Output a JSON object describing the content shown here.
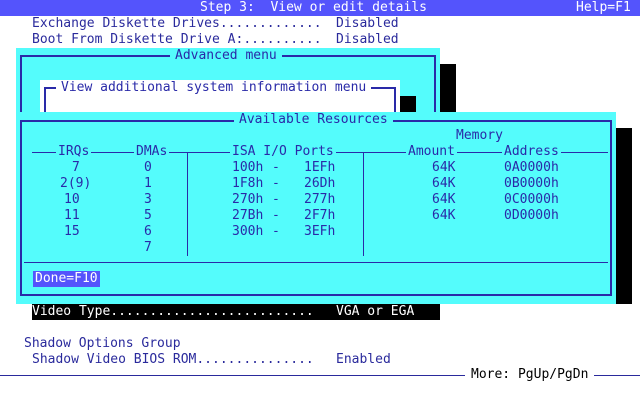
{
  "header": {
    "title": "Step 3:  View or edit details",
    "help": "Help=F1"
  },
  "background": {
    "rows_top": [
      {
        "label": "Exchange Diskette Drives.............",
        "value": "Disabled"
      },
      {
        "label": "Boot From Diskette Drive A:..........",
        "value": "Disabled"
      }
    ],
    "video_row": {
      "label": "Video Type..........................",
      "value": "VGA or EGA"
    },
    "shadow_group_title": "Shadow Options Group",
    "shadow_row": {
      "label": "Shadow Video BIOS ROM...............",
      "value": "Enabled"
    }
  },
  "advanced_menu": {
    "title": "Advanced menu",
    "submenu_title": "View additional system information menu"
  },
  "resources": {
    "title": "Available Resources",
    "memory_header": "Memory",
    "columns": {
      "irqs": "IRQs",
      "dmas": "DMAs",
      "ports": "ISA I/O Ports",
      "amount": "Amount",
      "address": "Address"
    },
    "irqs": [
      "7",
      "2(9)",
      "10",
      "11",
      "15"
    ],
    "dmas": [
      "0",
      "1",
      "3",
      "5",
      "6",
      "7"
    ],
    "ports": [
      {
        "from": "100h",
        "dash": "-",
        "to": "1EFh"
      },
      {
        "from": "1F8h",
        "dash": "-",
        "to": "26Dh"
      },
      {
        "from": "270h",
        "dash": "-",
        "to": "277h"
      },
      {
        "from": "27Bh",
        "dash": "-",
        "to": "2F7h"
      },
      {
        "from": "300h",
        "dash": "-",
        "to": "3EFh"
      }
    ],
    "memory": [
      {
        "amount": "64K",
        "address": "0A0000h"
      },
      {
        "amount": "64K",
        "address": "0B0000h"
      },
      {
        "amount": "64K",
        "address": "0C0000h"
      },
      {
        "amount": "64K",
        "address": "0D0000h"
      }
    ],
    "done_label": "Done=F10"
  },
  "footer": {
    "more": "More: PgUp/PgDn"
  },
  "colors": {
    "title_bar": "#5454fc",
    "window": "#54fcfc",
    "text": "#2a2aa8"
  }
}
